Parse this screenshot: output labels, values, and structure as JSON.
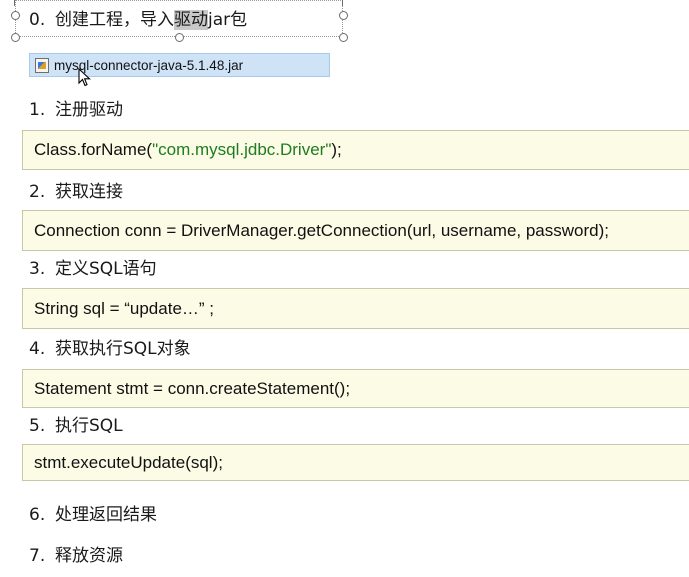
{
  "steps": [
    {
      "num": "0.",
      "text_before": "创建工程，导入",
      "text_highlight": "驱动",
      "text_after": "jar包"
    },
    {
      "num": "1.",
      "text": "注册驱动"
    },
    {
      "num": "2.",
      "text": "获取连接"
    },
    {
      "num": "3.",
      "text": "定义SQL语句"
    },
    {
      "num": "4.",
      "text": "获取执行SQL对象"
    },
    {
      "num": "5.",
      "text": "执行SQL"
    },
    {
      "num": "6.",
      "text": "处理返回结果"
    },
    {
      "num": "7.",
      "text": "释放资源"
    }
  ],
  "file": {
    "name": "mysql-connector-java-5.1.48.jar",
    "icon": "jar-file-icon"
  },
  "code": {
    "register_prefix": "Class.forName(",
    "register_string": "\"com.mysql.jdbc.Driver\"",
    "register_suffix": ");",
    "connection": "Connection conn = DriverManager.getConnection(url, username, password);",
    "sql": "String sql = “update…” ;",
    "statement": "Statement stmt = conn.createStatement();",
    "execute": "stmt.executeUpdate(sql);"
  },
  "colors": {
    "code_bg": "#fbfbe6",
    "string": "#1e7d1e",
    "file_highlight": "#cfe3f7"
  }
}
